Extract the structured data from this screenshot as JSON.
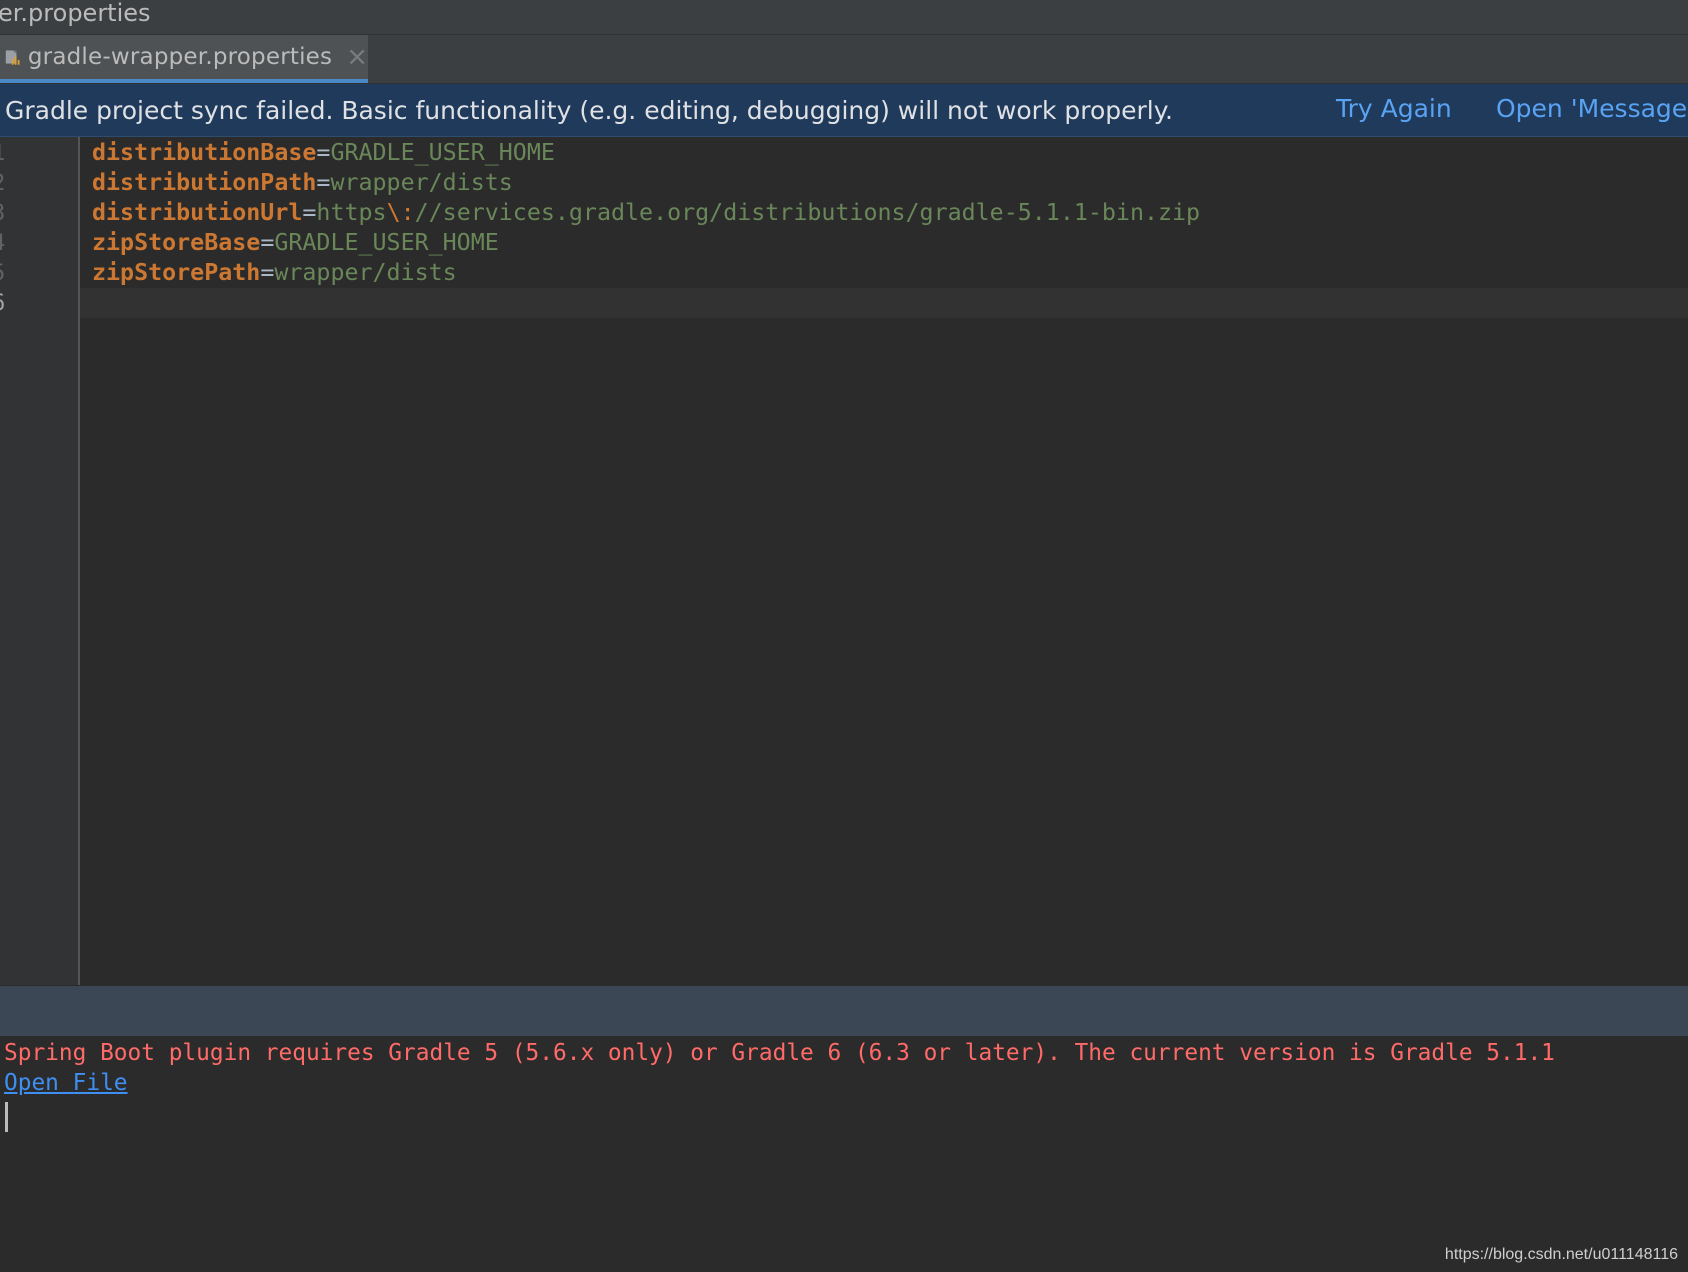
{
  "window": {
    "title": "er.properties"
  },
  "tab": {
    "label": "gradle-wrapper.properties",
    "icon": "gradle-file-icon",
    "close": "×"
  },
  "banner": {
    "message": "Gradle project sync failed. Basic functionality (e.g. editing, debugging) will not work properly.",
    "try_again": "Try Again",
    "open_messages": "Open 'Messages' View"
  },
  "gutter": {
    "line_numbers": [
      "1",
      "2",
      "3",
      "4",
      "5",
      "6"
    ]
  },
  "code": [
    {
      "key": "distributionBase",
      "eq": "=",
      "value": "GRADLE_USER_HOME"
    },
    {
      "key": "distributionPath",
      "eq": "=",
      "value": "wrapper/dists"
    },
    {
      "key": "distributionUrl",
      "eq": "=",
      "value_pre": "https",
      "escape": "\\:",
      "value_post": "//services.gradle.org/distributions/gradle-5.1.1-bin.zip"
    },
    {
      "key": "zipStoreBase",
      "eq": "=",
      "value": "GRADLE_USER_HOME"
    },
    {
      "key": "zipStorePath",
      "eq": "=",
      "value": "wrapper/dists"
    }
  ],
  "console": {
    "error": "Spring Boot plugin requires Gradle 5 (5.6.x only) or Gradle 6 (6.3 or later). The current version is Gradle 5.1.1",
    "link": "Open File"
  },
  "watermark": "https://blog.csdn.net/u011148116",
  "colors": {
    "keyword": "#cc7832",
    "value": "#6a8759",
    "error": "#ff6b68",
    "link": "#5aa2f3",
    "banner_bg": "#1f3a5a"
  }
}
